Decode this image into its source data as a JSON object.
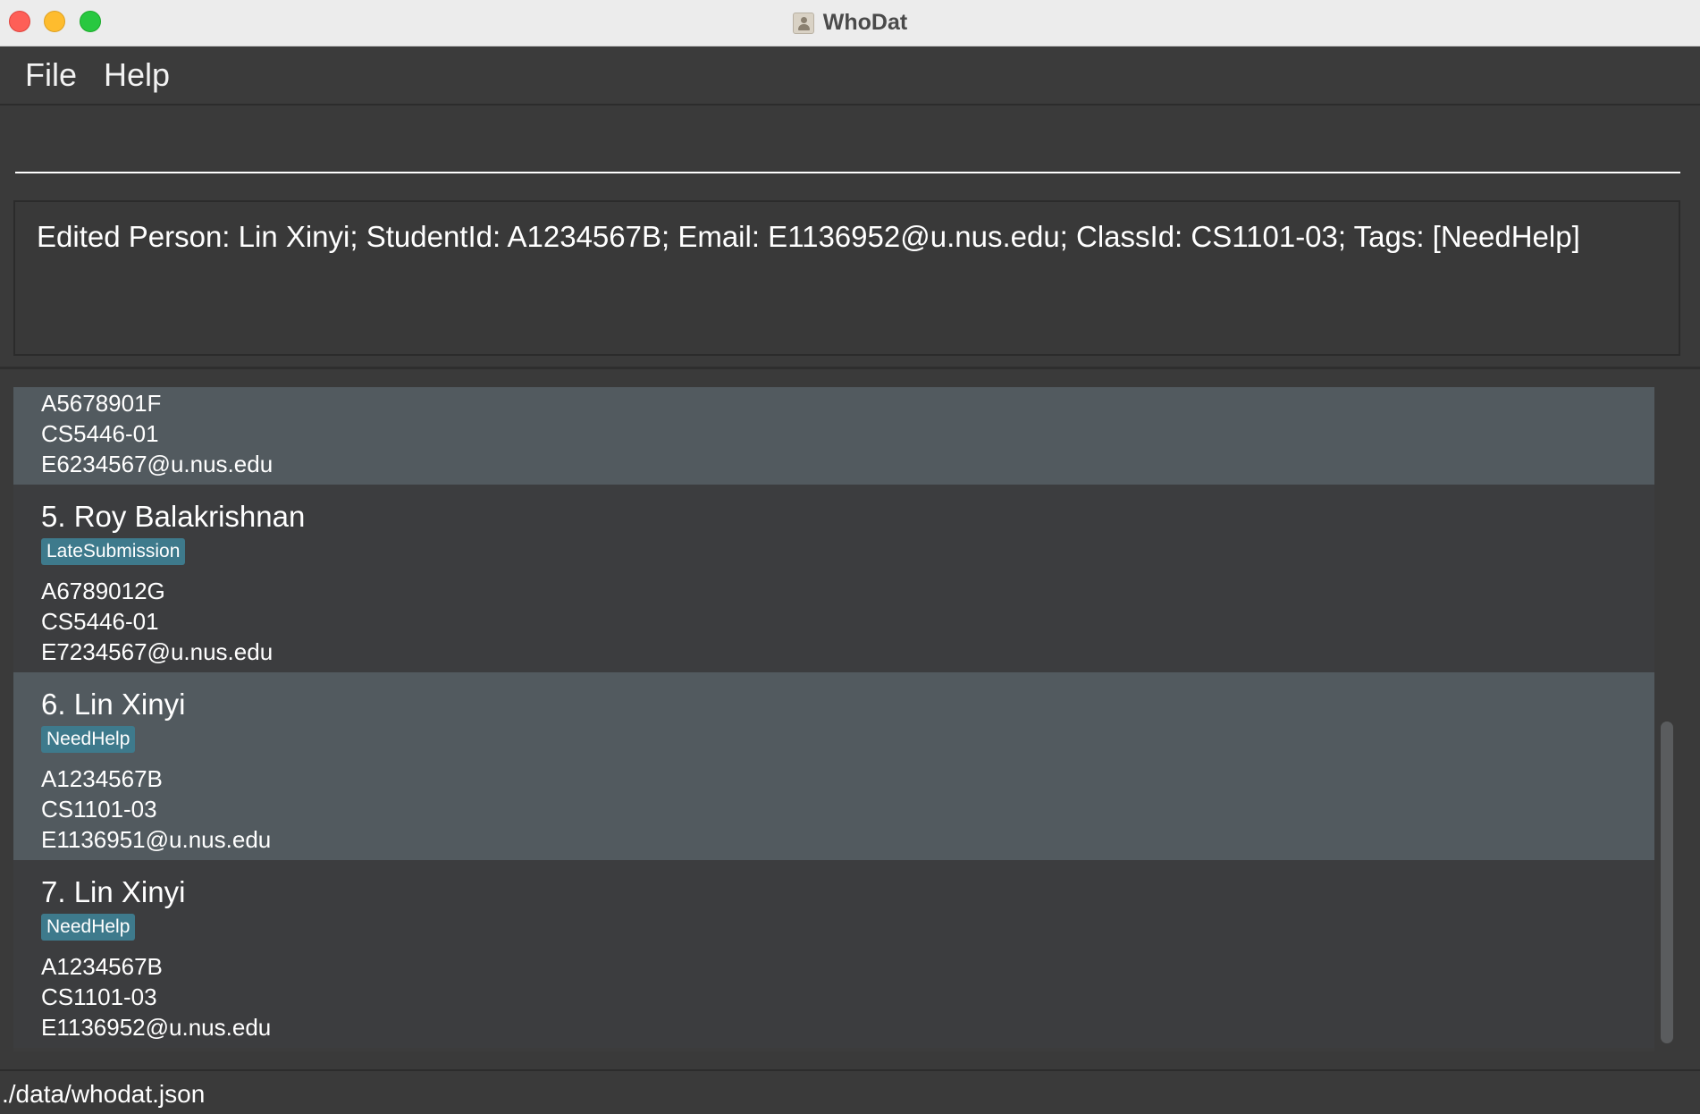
{
  "window": {
    "title": "WhoDat"
  },
  "menu": {
    "items": [
      "File",
      "Help"
    ]
  },
  "command": {
    "value": "",
    "placeholder": ""
  },
  "result": {
    "text": "Edited Person: Lin Xinyi; StudentId: A1234567B; Email: E1136952@u.nus.edu; ClassId: CS1101-03; Tags: [NeedHelp]"
  },
  "persons": [
    {
      "name": "",
      "tag": "",
      "student_id": "A5678901F",
      "class_id": "CS5446-01",
      "email": "E6234567@u.nus.edu"
    },
    {
      "name": "5. Roy Balakrishnan",
      "tag": "LateSubmission",
      "student_id": "A6789012G",
      "class_id": "CS5446-01",
      "email": "E7234567@u.nus.edu"
    },
    {
      "name": "6. Lin Xinyi",
      "tag": "NeedHelp",
      "student_id": "A1234567B",
      "class_id": "CS1101-03",
      "email": "E1136951@u.nus.edu"
    },
    {
      "name": "7. Lin Xinyi",
      "tag": "NeedHelp",
      "student_id": "A1234567B",
      "class_id": "CS1101-03",
      "email": "E1136952@u.nus.edu"
    }
  ],
  "status": {
    "path": "./data/whodat.json"
  }
}
